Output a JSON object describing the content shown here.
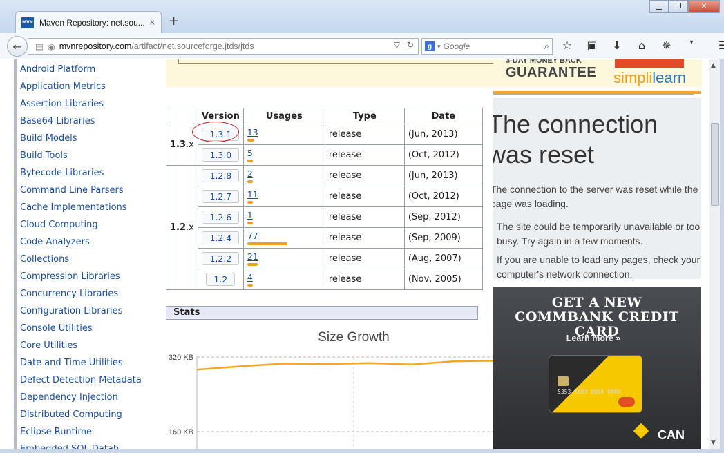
{
  "browser": {
    "tab_title": "Maven Repository: net.sou...",
    "tab_close": "×",
    "new_tab": "+",
    "favicon": "MVN",
    "url_host": "mvnrepository.com",
    "url_path": "/artifact/net.sourceforge.jtds/jtds",
    "search_placeholder": "Google",
    "search_logo": "g"
  },
  "sidebar": {
    "items": [
      "Android Platform",
      "Application Metrics",
      "Assertion Libraries",
      "Base64 Libraries",
      "Build Models",
      "Build Tools",
      "Bytecode Libraries",
      "Command Line Parsers",
      "Cache Implementations",
      "Cloud Computing",
      "Code Analyzers",
      "Collections",
      "Compression Libraries",
      "Concurrency Libraries",
      "Configuration Libraries",
      "Console Utilities",
      "Core Utilities",
      "Date and Time Utilities",
      "Defect Detection Metadata",
      "Dependency Injection",
      "Distributed Computing",
      "Eclipse Runtime",
      "Embedded SQL Datab..."
    ]
  },
  "promo": {
    "money_back_small": "3-DAY MONEY BACK",
    "money_back_big": "GUARANTEE",
    "brand_a": "simpl",
    "brand_b": "i",
    "brand_c": "learn"
  },
  "versions_table": {
    "headers": [
      "Version",
      "Usages",
      "Type",
      "Date"
    ],
    "groups": [
      {
        "label": "1.3",
        "suffix": ".x",
        "rows": [
          {
            "version": "1.3.1",
            "usages": "13",
            "usage_pct": 0.17,
            "type": "release",
            "date": "(Jun, 2013)"
          },
          {
            "version": "1.3.0",
            "usages": "5",
            "usage_pct": 0.07,
            "type": "release",
            "date": "(Oct, 2012)"
          }
        ]
      },
      {
        "label": "1.2",
        "suffix": ".x",
        "rows": [
          {
            "version": "1.2.8",
            "usages": "2",
            "usage_pct": 0.03,
            "type": "release",
            "date": "(Jun, 2013)"
          },
          {
            "version": "1.2.7",
            "usages": "11",
            "usage_pct": 0.14,
            "type": "release",
            "date": "(Oct, 2012)"
          },
          {
            "version": "1.2.6",
            "usages": "1",
            "usage_pct": 0.02,
            "type": "release",
            "date": "(Sep, 2012)"
          },
          {
            "version": "1.2.4",
            "usages": "77",
            "usage_pct": 1.0,
            "type": "release",
            "date": "(Sep, 2009)"
          },
          {
            "version": "1.2.2",
            "usages": "21",
            "usage_pct": 0.27,
            "type": "release",
            "date": "(Aug, 2007)"
          },
          {
            "version": "1.2",
            "usages": "4",
            "usage_pct": 0.06,
            "type": "release",
            "date": "(Nov, 2005)"
          }
        ]
      }
    ]
  },
  "stats": {
    "heading": "Stats"
  },
  "chart_data": {
    "type": "line",
    "title": "Size Growth",
    "yticks": [
      "320 KB",
      "160 KB"
    ],
    "ytick_values": [
      320,
      160
    ],
    "series": [
      {
        "values": [
          293,
          300,
          306,
          305,
          307,
          304,
          311,
          312
        ]
      }
    ]
  },
  "error_page": {
    "title_line1": "The connection",
    "title_line2": "was reset",
    "desc": "The connection to the server was reset while the page was loading.",
    "bullets": [
      "The site could be temporarily unavailable or too busy. Try again in a few moments.",
      "If you are unable to load any pages, check your computer's network connection."
    ]
  },
  "ad": {
    "headline1": "GET A NEW",
    "headline2": "COMMBANK CREDIT CARD",
    "learn_more": "Learn more »",
    "card_number": "5353 1603 0000 0000",
    "logo": "CAN"
  },
  "colors": {
    "link": "#1a4fa0",
    "bar": "#f0a020",
    "line": "#f5a623",
    "highlight": "#c02020"
  }
}
